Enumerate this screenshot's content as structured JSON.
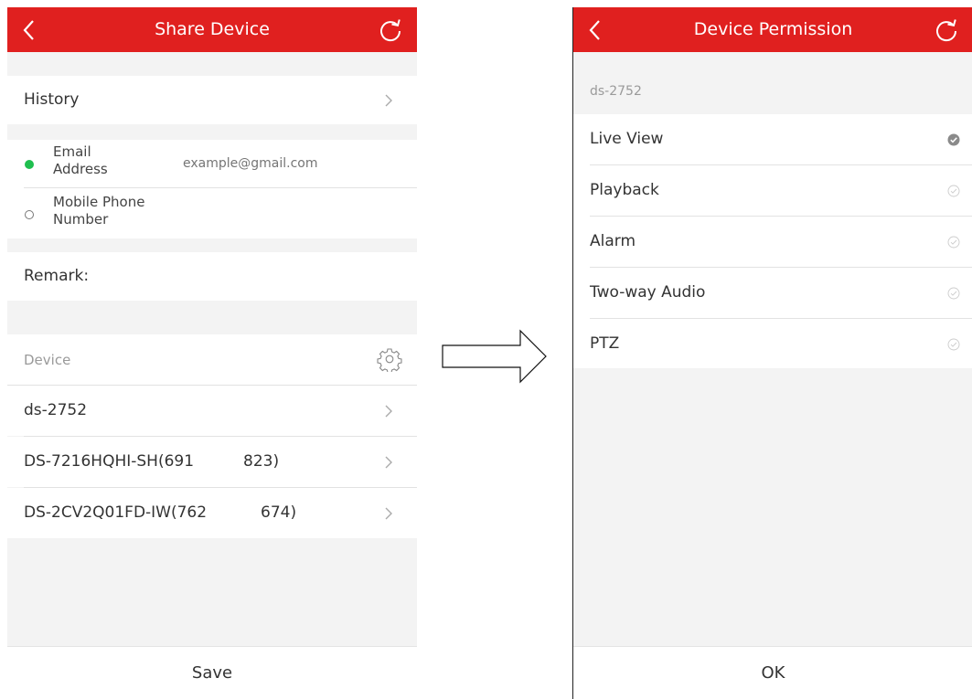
{
  "share_device": {
    "title": "Share Device",
    "history_label": "History",
    "email_label_line1": "Email",
    "email_label_line2": "Address",
    "email_placeholder": "example@gmail.com",
    "phone_label_line1": "Mobile Phone",
    "phone_label_line2": "Number",
    "remark_label": "Remark:",
    "device_section_label": "Device",
    "devices": [
      {
        "name": "ds-2752"
      },
      {
        "name": "DS-7216HQHI-SH(691",
        "suffix": "823)"
      },
      {
        "name": "DS-2CV2Q01FD-IW(762",
        "suffix": "674)"
      }
    ],
    "save_label": "Save",
    "accent_color": "#e0201f",
    "selected_radio_color": "#1fbf4f"
  },
  "device_permission": {
    "title": "Device Permission",
    "device_name": "ds-2752",
    "permissions": [
      {
        "label": "Live View",
        "checked": true
      },
      {
        "label": "Playback",
        "checked": false
      },
      {
        "label": "Alarm",
        "checked": false
      },
      {
        "label": "Two-way Audio",
        "checked": false
      },
      {
        "label": "PTZ",
        "checked": false
      }
    ],
    "ok_label": "OK"
  }
}
